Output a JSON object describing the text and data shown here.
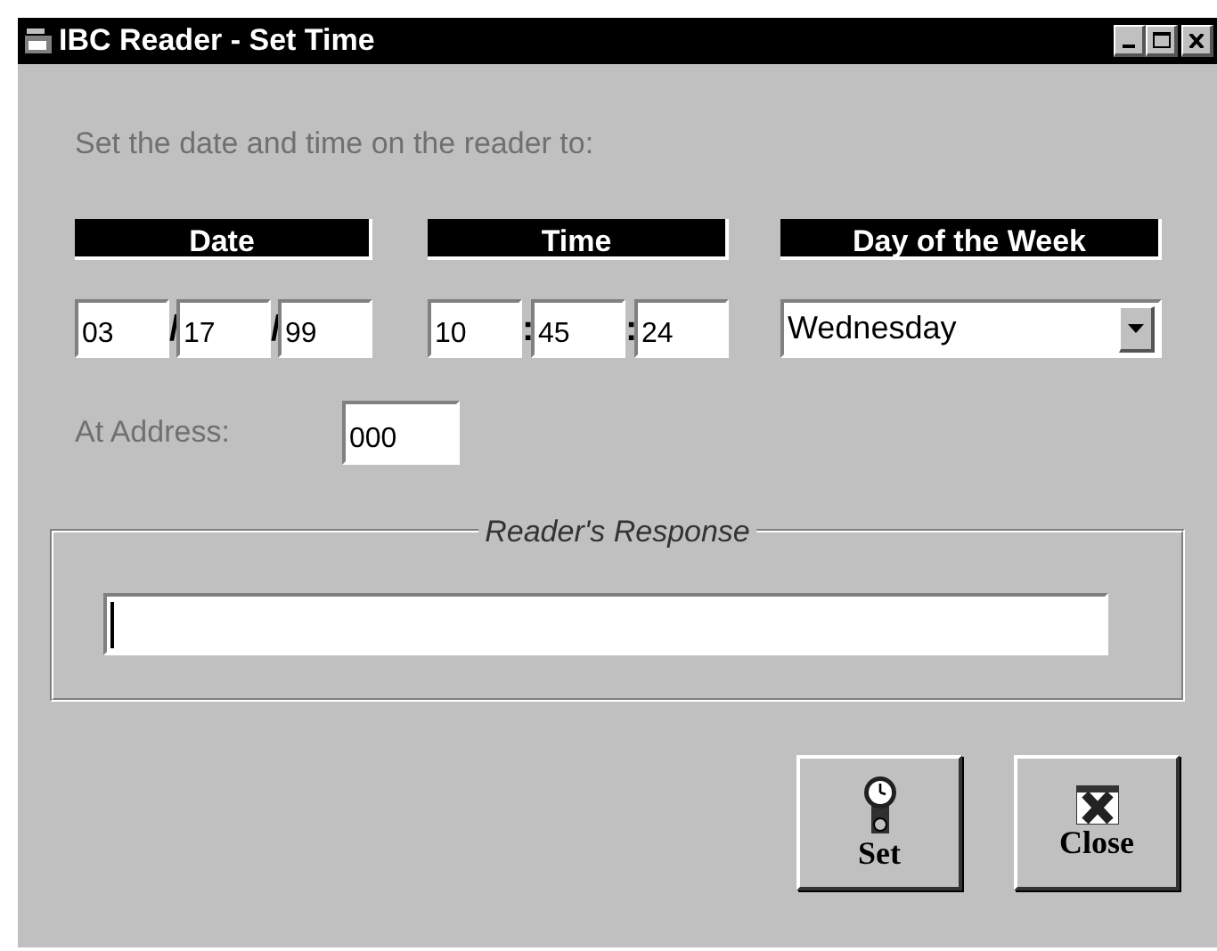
{
  "window": {
    "title": "IBC Reader - Set Time"
  },
  "instruction": "Set the date and time on the reader to:",
  "date": {
    "header": "Date",
    "fields": [
      {
        "value": "03"
      },
      {
        "value": "17"
      },
      {
        "value": "99"
      }
    ],
    "separators": [
      "/",
      "/"
    ]
  },
  "time": {
    "header": "Time",
    "fields": [
      {
        "value": "10"
      },
      {
        "value": "45"
      },
      {
        "value": "24"
      }
    ],
    "separators": [
      ":",
      ":"
    ]
  },
  "day_of_week": {
    "header": "Day of the Week",
    "value": "Wednesday"
  },
  "address": {
    "label": "At Address:",
    "value": "000"
  },
  "response": {
    "title": "Reader's Response"
  },
  "buttons": [
    {
      "label": "Set",
      "kind": "clock"
    },
    {
      "label": "Close",
      "kind": "close"
    }
  ]
}
